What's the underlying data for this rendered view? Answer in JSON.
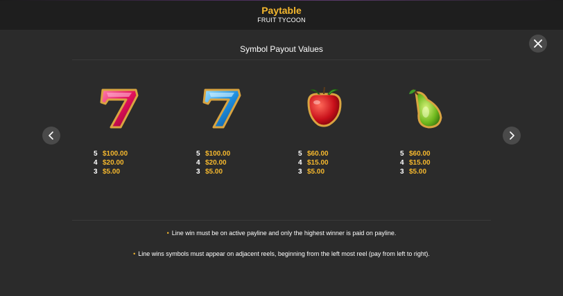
{
  "header": {
    "title": "Paytable",
    "subtitle": "FRUIT TYCOON"
  },
  "section_title": "Symbol Payout Values",
  "symbols": [
    {
      "icon": "red-seven-icon",
      "payouts": [
        {
          "count": "5",
          "amount": "$100.00"
        },
        {
          "count": "4",
          "amount": "$20.00"
        },
        {
          "count": "3",
          "amount": "$5.00"
        }
      ]
    },
    {
      "icon": "blue-seven-icon",
      "payouts": [
        {
          "count": "5",
          "amount": "$100.00"
        },
        {
          "count": "4",
          "amount": "$20.00"
        },
        {
          "count": "3",
          "amount": "$5.00"
        }
      ]
    },
    {
      "icon": "strawberry-icon",
      "payouts": [
        {
          "count": "5",
          "amount": "$60.00"
        },
        {
          "count": "4",
          "amount": "$15.00"
        },
        {
          "count": "3",
          "amount": "$5.00"
        }
      ]
    },
    {
      "icon": "pear-icon",
      "payouts": [
        {
          "count": "5",
          "amount": "$60.00"
        },
        {
          "count": "4",
          "amount": "$15.00"
        },
        {
          "count": "3",
          "amount": "$5.00"
        }
      ]
    }
  ],
  "rules": [
    {
      "bullet": "•",
      "text": "Line win must be on active payline and only the highest winner is paid on payline."
    },
    {
      "bullet": "•",
      "text": "Line wins symbols must appear on adjacent reels, beginning from the left most reel (pay from left to right)."
    }
  ],
  "colors": {
    "accent": "#f5b82e",
    "background": "#2b2b2b",
    "header": "#1e1e1e",
    "button": "#4a4a4a"
  }
}
